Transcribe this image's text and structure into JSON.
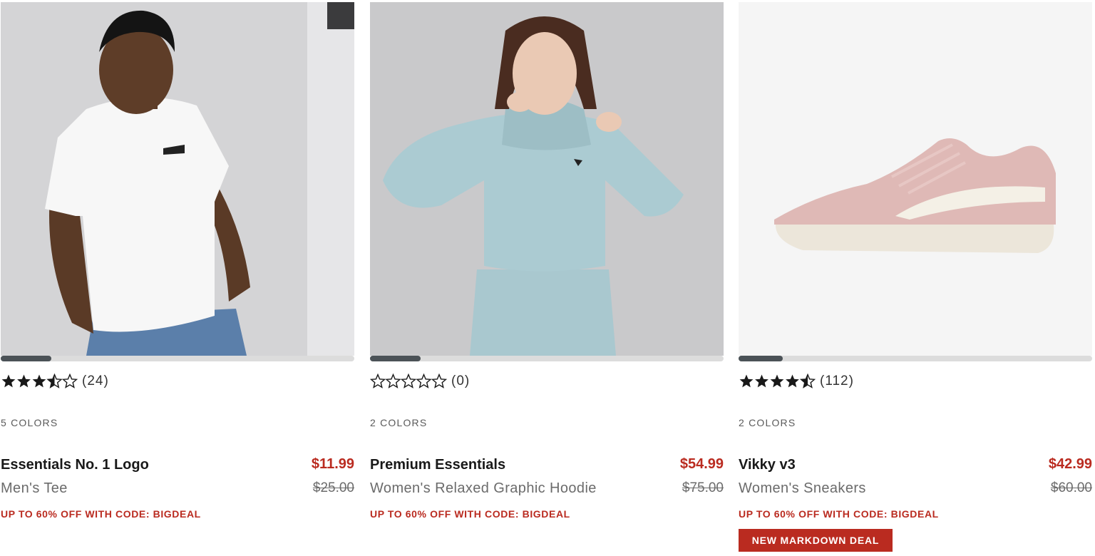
{
  "products": [
    {
      "rating_value": 3.5,
      "rating_count": "(24)",
      "colors": "5 COLORS",
      "name": "Essentials No. 1 Logo",
      "subtitle": "Men's Tee",
      "sale_price": "$11.99",
      "original_price": "$25.00",
      "promo": "UP TO 60% OFF WITH CODE: BIGDEAL",
      "carousel_position": 0.14
    },
    {
      "rating_value": 0,
      "rating_count": "(0)",
      "colors": "2 COLORS",
      "name": "Premium Essentials",
      "subtitle": "Women's Relaxed Graphic Hoodie",
      "sale_price": "$54.99",
      "original_price": "$75.00",
      "promo": "UP TO 60% OFF WITH CODE: BIGDEAL",
      "carousel_position": 0.14
    },
    {
      "rating_value": 4.5,
      "rating_count": "(112)",
      "colors": "2 COLORS",
      "name": "Vikky v3",
      "subtitle": "Women's Sneakers",
      "sale_price": "$42.99",
      "original_price": "$60.00",
      "promo": "UP TO 60% OFF WITH CODE: BIGDEAL",
      "badge": "NEW MARKDOWN DEAL",
      "carousel_position": 0.125
    }
  ],
  "colors": {
    "sale_red": "#ba2b20",
    "text_dark": "#191919",
    "text_muted": "#6b6b6b",
    "carousel_track": "#dcdcdc",
    "carousel_thumb": "#4b5257"
  },
  "icons": {
    "star_full": "star-filled-icon",
    "star_half": "star-half-icon",
    "star_empty": "star-outline-icon"
  }
}
